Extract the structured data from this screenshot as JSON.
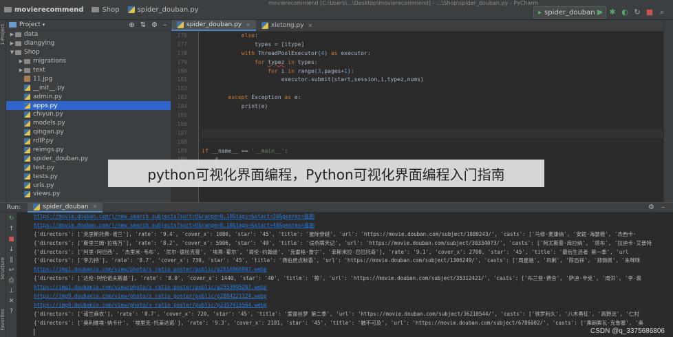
{
  "titlebar": {
    "project": "movierecommend",
    "folder": "Shop",
    "file": "spider_douban.py",
    "window_title": "movierecommend [C:\\Users\\...\\Desktop\\movierecommend] - ...\\Shop\\spider_douban.py - PyCharm",
    "run_config": "spider_douban"
  },
  "project_panel": {
    "title": "Project",
    "items": [
      {
        "label": "data",
        "type": "dir",
        "level": 1,
        "expanded": false
      },
      {
        "label": "diangying",
        "type": "dir",
        "level": 1,
        "expanded": false
      },
      {
        "label": "Shop",
        "type": "dir",
        "level": 1,
        "expanded": true
      },
      {
        "label": "migrations",
        "type": "dir",
        "level": 2,
        "expanded": false
      },
      {
        "label": "text",
        "type": "dir",
        "level": 2,
        "expanded": false
      },
      {
        "label": "11.jpg",
        "type": "img",
        "level": 2
      },
      {
        "label": "__init__.py",
        "type": "py",
        "level": 2
      },
      {
        "label": "admin.py",
        "type": "py",
        "level": 2
      },
      {
        "label": "apps.py",
        "type": "py",
        "level": 2,
        "selected": true
      },
      {
        "label": "chiyun.py",
        "type": "py",
        "level": 2
      },
      {
        "label": "models.py",
        "type": "py",
        "level": 2
      },
      {
        "label": "qingan.py",
        "type": "py",
        "level": 2
      },
      {
        "label": "rdIP.py",
        "type": "py",
        "level": 2
      },
      {
        "label": "reimgs.py",
        "type": "py",
        "level": 2
      },
      {
        "label": "spider_douban.py",
        "type": "py",
        "level": 2
      },
      {
        "label": "test.py",
        "type": "py",
        "level": 2
      },
      {
        "label": "tests.py",
        "type": "py",
        "level": 2
      },
      {
        "label": "urls.py",
        "type": "py",
        "level": 2
      },
      {
        "label": "views.py",
        "type": "py",
        "level": 2
      }
    ]
  },
  "editor": {
    "tabs": [
      {
        "label": "spider_douban.py",
        "active": true
      },
      {
        "label": "xietong.py",
        "active": false
      }
    ],
    "line_numbers": [
      "176",
      "177",
      "178",
      "179",
      "180",
      "181",
      "182",
      "183",
      "184",
      "185",
      "186",
      "187",
      "188",
      "189",
      "190",
      "191",
      "192"
    ]
  },
  "overlay_text": "python可视化界面编程，Python可视化界面编程入门指南",
  "run_panel": {
    "label": "Run:",
    "tab": "spider_douban",
    "lines": [
      {
        "text": "https://movie.douban.com/j/new_search_subjects?sort=U&range=0,10&tags=&start=20&genres=喜剧",
        "link": true
      },
      {
        "text": "https://movie.douban.com/j/new_search_subjects?sort=U&range=0,10&tags=&start=40&genres=喜剧",
        "link": true
      },
      {
        "text": "{'directors': ['克里斯托弗·诺兰'], 'rate': '9.4', 'cover_x': 1080, 'star': '45', 'title': '星际穿越', 'url': 'https://movie.douban.com/subject/1889243/', 'casts': ['马修·麦康纳', '安妮·海瑟薇', '杰西卡·",
        "link": false
      },
      {
        "text": "{'directors': ['斯里兰姆·拉格万'], 'rate': '8.2', 'cover_x': 5906, 'star': '40', 'title': '误杀瞒天记', 'url': 'https://movie.douban.com/subject/30334073/', 'casts': ['阿尤斯曼·库拉纳', '塔布', '拉迪卡·艾普特",
        "link": false
      },
      {
        "text": "{'directors': ['阿里·阿巴西', '杰里米·韦布', '尼尔·德拉克曼', '埃弗·霍尔', '哥伦·约翰逊', '克雷格·詹宁', '菲斯米拉·巴巴托奇'], 'rate': '9.1', 'cover_x': 2700, 'star': '45', 'title': '最后生还者 第一季', 'url",
        "link": false
      },
      {
        "text": "{'directors': ['李力持'], 'rate': '8.7', 'cover_x': 730, 'star': '45', 'title': '唐伯虎点秋香', 'url': 'https://movie.douban.com/subject/1306249/', 'casts': ['周星驰', '巩俐', '陈百祥', '郑佩佩', '朱咪咪",
        "link": false
      },
      {
        "text": "https://img1.doubanio.com/view/photo/s_ratio_poster/public/p2616066997.webp",
        "link": true
      },
      {
        "text": "{'directors': ['达伦·阿伦诺夫斯基'], 'rate': '8.0', 'cover_x': 1440, 'star': '40', 'title': '鲸', 'url': 'https://movie.douban.com/subject/35312421/', 'casts': ['布兰登·费舍', '萨迪·辛克', '周洪', '李·裴",
        "link": false
      },
      {
        "text": "https://img1.doubanio.com/view/photo/s_ratio_poster/public/p2553995207.webp",
        "link": true
      },
      {
        "text": "https://img9.doubanio.com/view/photo/s_ratio_poster/public/p2884221124.webp",
        "link": true
      },
      {
        "text": "https://img9.doubanio.com/view/photo/s_ratio_poster/public/p2357915564.webp",
        "link": true
      },
      {
        "text": "{'directors': ['诺兰麻衣'], 'rate': '8.7', 'cover_x': 720, 'star': '45', 'title': '爱丽丝梦 第二季', 'url': 'https://movie.douban.com/subject/36210544/', 'casts': ['铁罗利久', '八木勇征', '高野洸', '仁村",
        "link": false
      },
      {
        "text": "{'directors': ['奥利维埃·纳卡什', '埃里克·托莱达诺'], 'rate': '9.3', 'cover_x': 2181, 'star': '45', 'title': '触不可及', 'url': 'https://movie.douban.com/subject/6786002/', 'casts': ['弗朗索瓦·克鲁塞', '奥",
        "link": false
      }
    ]
  },
  "watermark": "CSDN @q_3375686806"
}
